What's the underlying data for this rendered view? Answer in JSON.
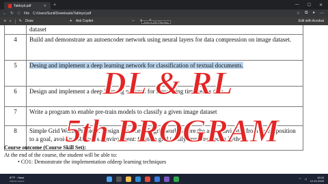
{
  "browser": {
    "tab_title": "Tabloyd.pdf",
    "address": "C:/Users/Sunil/Downloads/Tabloyd.pdf",
    "file_label": "File"
  },
  "pdf_toolbar": {
    "draw": "Draw",
    "ask_copilot": "Ask Copilot",
    "tooltip": "Zoom in (Ctrl+Plus key)",
    "edit_with_acrobat": "Edit with Acrobat"
  },
  "table": {
    "top_cont": "dataset",
    "rows": [
      {
        "no": "4",
        "text": "Build and demonstrate an autoencoder network using neural layers for data compression on image dataset."
      },
      {
        "no": "5",
        "text": "Desing and implement a deep learning network for classification of textual documents."
      },
      {
        "no": "6",
        "text": "Design and implement a deep learning network for forecasting time series data."
      },
      {
        "no": "7",
        "text": "Write a program to enable pre-train models to classify a given image dataset"
      },
      {
        "no": "8",
        "text": "Simple Grid World Problem: Design a custom 2D grid world where the agent navigates from a start position to a goal, avoiding obstacles. Environment: Custom grid (easily implemented in Python)"
      }
    ]
  },
  "course": {
    "heading": "Course outcome (Course Skill Set):",
    "intro": "At the end of the course, the student will be able to:",
    "co1": "CO1: Demonstrate the implementation ofdeep learning techniques"
  },
  "overlay": {
    "line1": "DL & RL",
    "line2": "5th PROGRAM"
  },
  "taskbar": {
    "weather_temp": "87°F · Haze",
    "weather_sub": "Game score",
    "time": "16:03",
    "date": "12-10-2025"
  }
}
